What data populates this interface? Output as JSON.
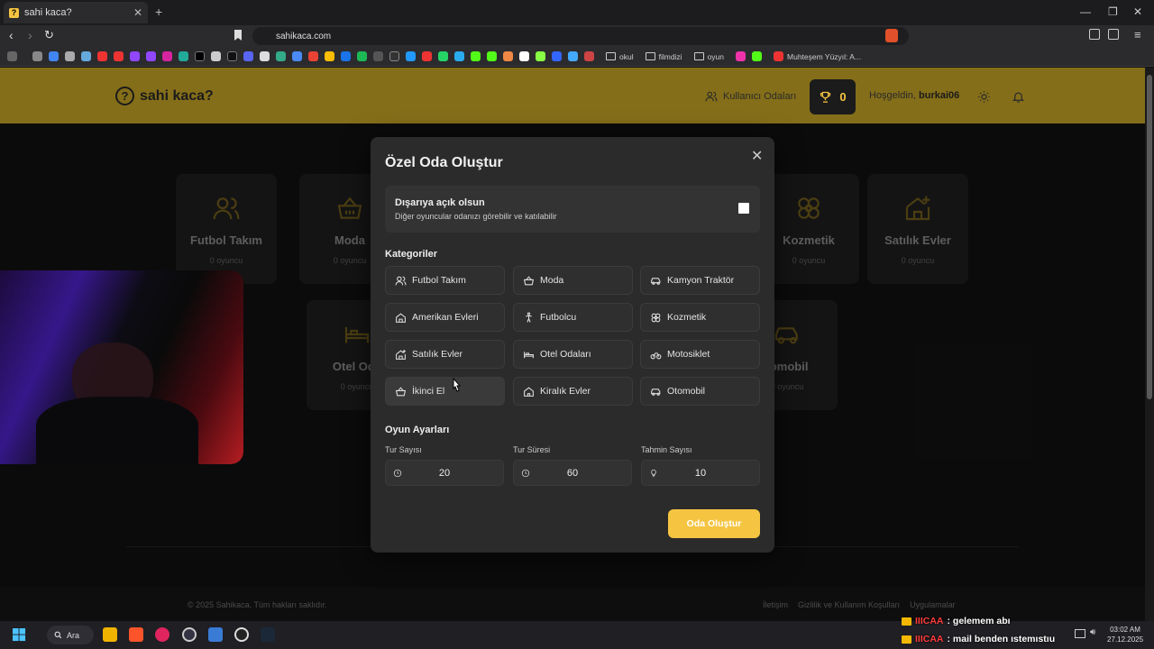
{
  "browser": {
    "tab_title": "sahi kaca?",
    "tab_favicon": "?",
    "url": "sahikaca.com",
    "bookmark_folders": [
      "okul",
      "filmdizi",
      "oyun"
    ],
    "bookmark_last": "Muhteşem Yüzyıl: A..."
  },
  "header": {
    "logo": "sahi kaca?",
    "rooms_link": "Kullanıcı Odaları",
    "trophy_count": "0",
    "welcome": "Hoşgeldin,",
    "username": "burkai06"
  },
  "background_categories": [
    {
      "name": "Futbol Takım",
      "count": "0 oyuncu",
      "icon": "users-icon"
    },
    {
      "name": "Moda",
      "count": "0 oyuncu",
      "icon": "basket-icon"
    },
    {
      "name": "Kozmetik",
      "count": "0 oyuncu",
      "icon": "flower-icon"
    },
    {
      "name": "Satılık Evler",
      "count": "0 oyuncu",
      "icon": "house-plus-icon"
    },
    {
      "name": "Otel Oda",
      "count": "0 oyuncu",
      "icon": "bed-icon"
    },
    {
      "name": "tomobil",
      "count": "0 oyuncu",
      "icon": "car-icon"
    }
  ],
  "modal": {
    "title": "Özel Oda Oluştur",
    "public_title": "Dışarıya açık olsun",
    "public_desc": "Diğer oyuncular odanızı görebilir ve katılabilir",
    "public_checked": false,
    "categories_heading": "Kategoriler",
    "categories": [
      {
        "label": "Futbol Takım",
        "icon": "users-icon"
      },
      {
        "label": "Moda",
        "icon": "basket-icon"
      },
      {
        "label": "Kamyon Traktör",
        "icon": "car-icon"
      },
      {
        "label": "Amerikan Evleri",
        "icon": "house-icon"
      },
      {
        "label": "Futbolcu",
        "icon": "person-icon"
      },
      {
        "label": "Kozmetik",
        "icon": "flower-icon"
      },
      {
        "label": "Satılık Evler",
        "icon": "house-plus-icon"
      },
      {
        "label": "Otel Odaları",
        "icon": "bed-icon"
      },
      {
        "label": "Motosiklet",
        "icon": "bike-icon"
      },
      {
        "label": "İkinci El",
        "icon": "basket-icon"
      },
      {
        "label": "Kiralık Evler",
        "icon": "home-icon"
      },
      {
        "label": "Otomobil",
        "icon": "car-icon"
      }
    ],
    "settings_heading": "Oyun Ayarları",
    "rounds_label": "Tur Sayısı",
    "rounds_value": "20",
    "duration_label": "Tur Süresi",
    "duration_value": "60",
    "guesses_label": "Tahmin Sayısı",
    "guesses_value": "10",
    "create_button": "Oda Oluştur"
  },
  "footer": {
    "copyright": "© 2025 Sahikaca. Tüm hakları saklıdır.",
    "links": [
      "İletişim",
      "Gizlilik ve Kullanım Koşulları",
      "Uygulamalar"
    ]
  },
  "taskbar": {
    "search": "Ara",
    "time": "03:02 AM",
    "date": "27.12.2025"
  },
  "chat": [
    {
      "user": "IIICAA",
      "message": ": gelemem abı"
    },
    {
      "user": "IIICAA",
      "message": ": mail benden ıstemıstıu"
    }
  ],
  "colors": {
    "accent": "#f5c542",
    "header": "#846e19",
    "modal": "#2b2b2b"
  }
}
